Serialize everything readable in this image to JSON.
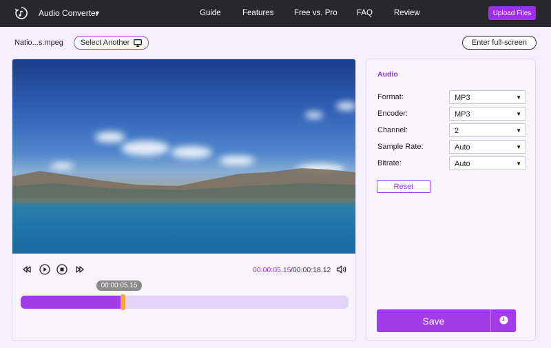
{
  "header": {
    "app_title": "Audio Converter",
    "nav": [
      "Guide",
      "Features",
      "Free vs. Pro",
      "FAQ",
      "Review"
    ],
    "upload_label": "Upload Files"
  },
  "file": {
    "name": "Natio...s.mpeg",
    "select_another_label": "Select Another",
    "fullscreen_label": "Enter full-screen"
  },
  "player": {
    "current_time": "00:00:05.15",
    "total_time": "/00:00:18.12",
    "tooltip_time": "00:00:05.15",
    "progress": 0.31
  },
  "settings": {
    "section_title": "Audio",
    "fields": [
      {
        "label": "Format:",
        "value": "MP3"
      },
      {
        "label": "Encoder:",
        "value": "MP3"
      },
      {
        "label": "Channel:",
        "value": "2"
      },
      {
        "label": "Sample Rate:",
        "value": "Auto"
      },
      {
        "label": "Bitrate:",
        "value": "Auto"
      }
    ],
    "reset_label": "Reset",
    "save_label": "Save"
  },
  "icons": {
    "logo": "refresh-music-icon",
    "monitor": "monitor-icon",
    "rewind": "rewind-icon",
    "play": "play-icon",
    "stop": "stop-icon",
    "forward": "fast-forward-icon",
    "volume": "volume-icon",
    "schedule": "clock-icon"
  },
  "colors": {
    "accent": "#a43be9",
    "topbar": "#28282a",
    "thumb": "#f4a532"
  }
}
